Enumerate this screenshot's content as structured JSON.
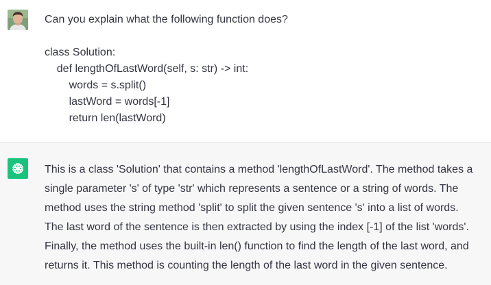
{
  "user_message": {
    "lines": [
      "Can you explain what the following function does?",
      "",
      "class Solution:",
      "    def lengthOfLastWord(self, s: str) -> int:",
      "        words = s.split()",
      "        lastWord = words[-1]",
      "        return len(lastWord)"
    ]
  },
  "assistant_message": {
    "lines": [
      "This is a class 'Solution' that contains a method 'lengthOfLastWord'. The method takes a",
      "single parameter 's' of type 'str' which represents a sentence or a string of words. The",
      "method uses the string method 'split' to split the given sentence 's' into a list of words.",
      "The last word of the sentence is then extracted by using the index [-1] of the list 'words'.",
      "Finally, the method uses the built-in len() function to find the length of the last word, and",
      "returns it. This method is counting the length of the last word in the given sentence."
    ]
  },
  "colors": {
    "assistant_accent": "#19c37d",
    "assistant_background": "#f7f7f8",
    "text": "#343541"
  },
  "icons": {
    "user_avatar": "user-avatar-icon",
    "assistant_avatar": "openai-logo-icon"
  }
}
